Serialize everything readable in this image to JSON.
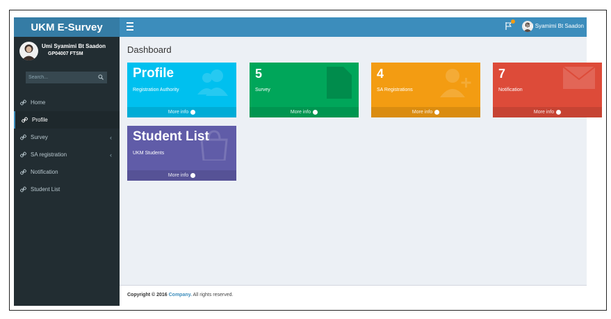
{
  "header": {
    "logo": "UKM E-Survey",
    "user_name": "Umi Syamimi Bt Saadon"
  },
  "sidebar": {
    "user": {
      "name": "Umi Syamimi Bt Saadon",
      "id": "GP04007 FTSM"
    },
    "search_placeholder": "Search...",
    "items": [
      {
        "label": "Home",
        "icon": "link-icon",
        "active": false,
        "caret": false
      },
      {
        "label": "Profile",
        "icon": "link-icon",
        "active": true,
        "caret": false
      },
      {
        "label": "Survey",
        "icon": "link-icon",
        "active": false,
        "caret": true
      },
      {
        "label": "SA registration",
        "icon": "link-icon",
        "active": false,
        "caret": true
      },
      {
        "label": "Notification",
        "icon": "link-icon",
        "active": false,
        "caret": false
      },
      {
        "label": "Student List",
        "icon": "link-icon",
        "active": false,
        "caret": false
      }
    ]
  },
  "main": {
    "title": "Dashboard",
    "boxes": [
      {
        "heading": "Profile",
        "label": "Registration Authority",
        "footer": "More info",
        "color": "#00c0ef",
        "icon": "users-icon"
      },
      {
        "heading": "5",
        "label": "Survey",
        "footer": "More info",
        "color": "#00a65a",
        "icon": "file-icon"
      },
      {
        "heading": "4",
        "label": "SA Registrations",
        "footer": "More info",
        "color": "#f39c12",
        "icon": "user-plus-icon"
      },
      {
        "heading": "7",
        "label": "Notification",
        "footer": "More info",
        "color": "#dd4b39",
        "icon": "envelope-icon"
      },
      {
        "heading": "Student List",
        "label": "UKM Students",
        "footer": "More info",
        "color": "#605ca8",
        "icon": "shopping-bag-icon"
      }
    ]
  },
  "footer": {
    "prefix": "Copyright © 2016 ",
    "company": "Company.",
    "suffix": " All rights reserved."
  }
}
